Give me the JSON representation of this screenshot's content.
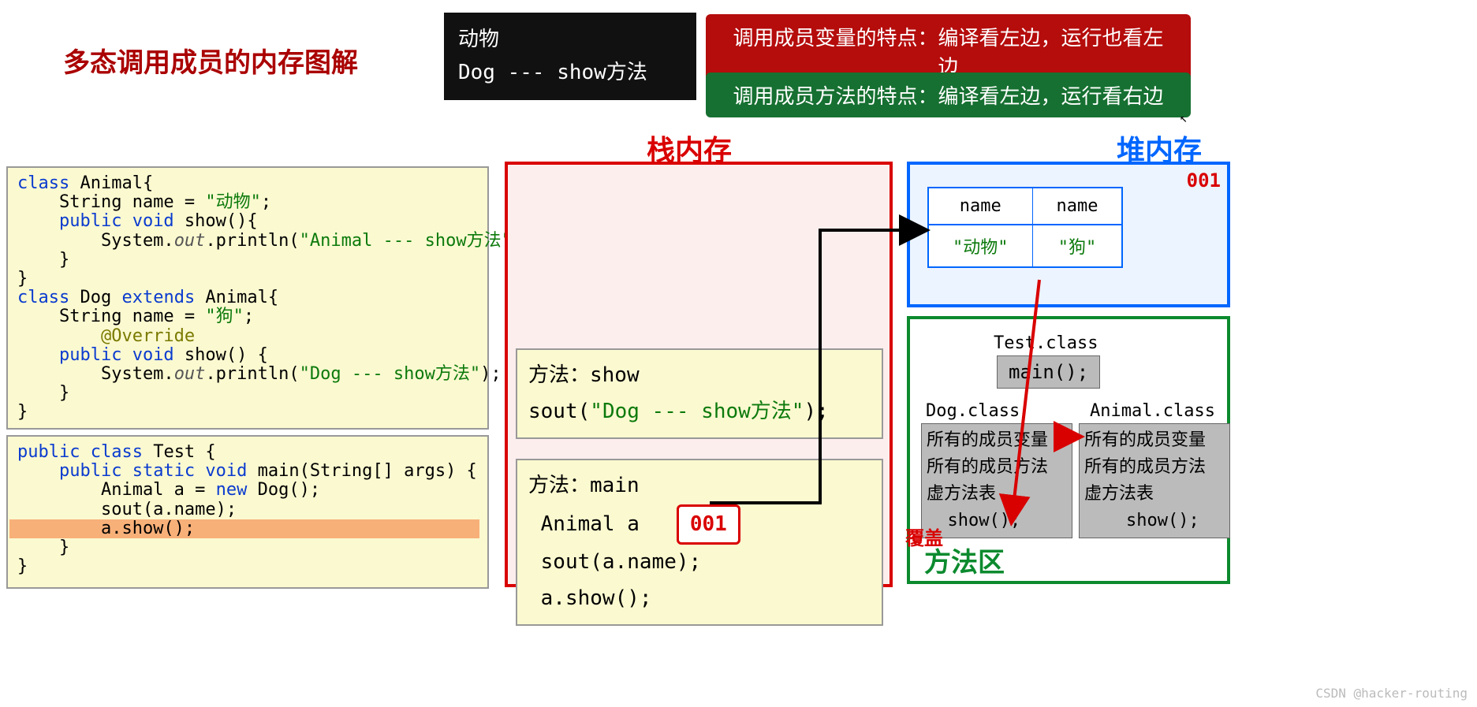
{
  "title": "多态调用成员的内存图解",
  "console": {
    "line1": "动物",
    "line2": "Dog --- show方法"
  },
  "banners": {
    "variable": "调用成员变量的特点：编译看左边，运行也看左边",
    "method": "调用成员方法的特点：编译看左边，运行看右边"
  },
  "labels": {
    "stack": "栈内存",
    "heap": "堆内存",
    "method_area": "方法区"
  },
  "code": {
    "animal_header": "class Animal{",
    "animal_name_decl": "    String name = ",
    "animal_name_val": "\"动物\"",
    "animal_show_sig": "    public void show(){",
    "animal_sout_call": "        System.out.println(",
    "animal_sout_arg": "\"Animal --- show方法\"",
    "close_brace2": "    }",
    "close_brace1": "}",
    "dog_header": "class Dog extends Animal{",
    "dog_name_decl": "    String name = ",
    "dog_name_val": "\"狗\"",
    "override": "    @Override",
    "dog_show_sig": "    public void show() {",
    "dog_sout_call": "        System.out.println(",
    "dog_sout_arg": "\"Dog --- show方法\"",
    "test_header": "public class Test {",
    "main_sig": "    public static void main(String[] args) {",
    "new_dog": "        Animal a = new Dog();",
    "sout_name": "        sout(a.name);",
    "a_show": "        a.show();"
  },
  "stack": {
    "frame_show": {
      "header": "方法：show",
      "body": "sout(\"Dog --- show方法\");",
      "body_arg": "Dog --- show方法"
    },
    "frame_main": {
      "header": "方法：main",
      "var": "Animal a",
      "addr": "001",
      "l1": "sout(a.name);",
      "l2": "a.show();"
    }
  },
  "heap": {
    "address": "001",
    "cols": [
      {
        "field": "name",
        "value": "\"动物\""
      },
      {
        "field": "name",
        "value": "\"狗\""
      }
    ]
  },
  "method_area": {
    "test_class": "Test.class",
    "main_method": "main();",
    "dog_class": "Dog.class",
    "animal_class": "Animal.class",
    "members_var": "所有的成员变量",
    "members_method": "所有的成员方法",
    "vtable": "虚方法表",
    "show": "show();",
    "override_label": "覆盖"
  },
  "watermark": "CSDN @hacker-routing",
  "cursor_glyph": "↖"
}
